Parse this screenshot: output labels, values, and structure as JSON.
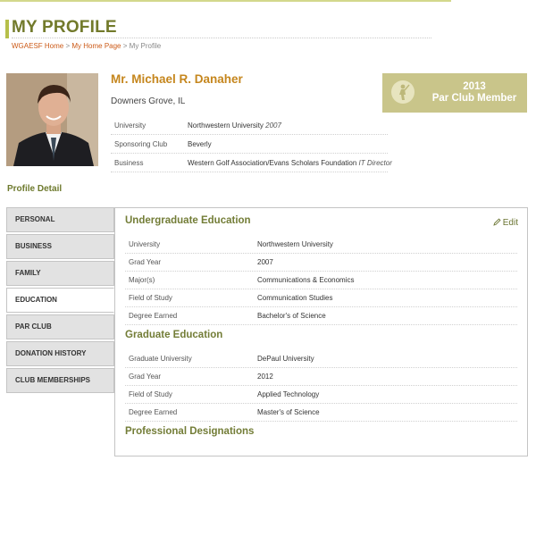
{
  "page": {
    "title": "MY PROFILE"
  },
  "breadcrumb": {
    "home": "WGAESF Home",
    "sep1": ">",
    "my_home": "My Home Page",
    "sep2": ">",
    "current": "My Profile"
  },
  "profile": {
    "name": "Mr. Michael R. Danaher",
    "location": "Downers Grove, IL",
    "rows": [
      {
        "label": "University",
        "value": "Northwestern University",
        "extra": "2007"
      },
      {
        "label": "Sponsoring Club",
        "value": "Beverly",
        "extra": ""
      },
      {
        "label": "Business",
        "value": "Western Golf Association/Evans Scholars Foundation",
        "extra": "IT Director"
      }
    ]
  },
  "par_club": {
    "year": "2013",
    "label": "Par Club Member"
  },
  "profile_detail": {
    "title": "Profile Detail"
  },
  "tabs": [
    "PERSONAL",
    "BUSINESS",
    "FAMILY",
    "EDUCATION",
    "PAR CLUB",
    "DONATION HISTORY",
    "CLUB MEMBERSHIPS"
  ],
  "active_tab": "EDUCATION",
  "education": {
    "edit_label": "Edit",
    "undergrad": {
      "heading": "Undergraduate Education",
      "rows": [
        {
          "label": "University",
          "value": "Northwestern University"
        },
        {
          "label": "Grad Year",
          "value": "2007"
        },
        {
          "label": "Major(s)",
          "value": "Communications & Economics"
        },
        {
          "label": "Field of Study",
          "value": "Communication Studies"
        },
        {
          "label": "Degree Earned",
          "value": "Bachelor's of Science"
        }
      ]
    },
    "graduate": {
      "heading": "Graduate Education",
      "rows": [
        {
          "label": "Graduate University",
          "value": "DePaul University"
        },
        {
          "label": "Grad Year",
          "value": "2012"
        },
        {
          "label": "Field of Study",
          "value": "Applied Technology"
        },
        {
          "label": "Degree Earned",
          "value": "Master's of Science"
        }
      ]
    },
    "professional": {
      "heading": "Professional Designations"
    }
  },
  "colors": {
    "accent_green": "#737d37",
    "name_gold": "#c5861d",
    "link_orange": "#cc5a17",
    "badge_bg": "#c9c58a"
  }
}
